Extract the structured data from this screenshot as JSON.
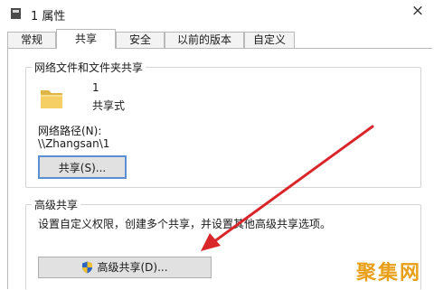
{
  "window": {
    "title": "1 属性",
    "close_glyph": "×"
  },
  "tabs": [
    {
      "label": "常规",
      "active": false
    },
    {
      "label": "共享",
      "active": true
    },
    {
      "label": "安全",
      "active": false
    },
    {
      "label": "以前的版本",
      "active": false
    },
    {
      "label": "自定义",
      "active": false
    }
  ],
  "network_share": {
    "group_title": "网络文件和文件夹共享",
    "item_name": "1",
    "item_status": "共享式",
    "path_label": "网络路径(N):",
    "path_value": "\\\\Zhangsan\\1",
    "share_button": "共享(S)..."
  },
  "advanced_share": {
    "group_title": "高级共享",
    "description": "设置自定义权限，创建多个共享，并设置其他高级共享选项。",
    "button": "高级共享(D)..."
  },
  "watermark": "聚集网",
  "colors": {
    "arrow": "#d8262b",
    "focus_border": "#5a8fd1",
    "watermark": "#e8a01a"
  },
  "icons": {
    "title": "properties-icon",
    "folder": "folder-icon",
    "shield": "uac-shield-icon"
  }
}
